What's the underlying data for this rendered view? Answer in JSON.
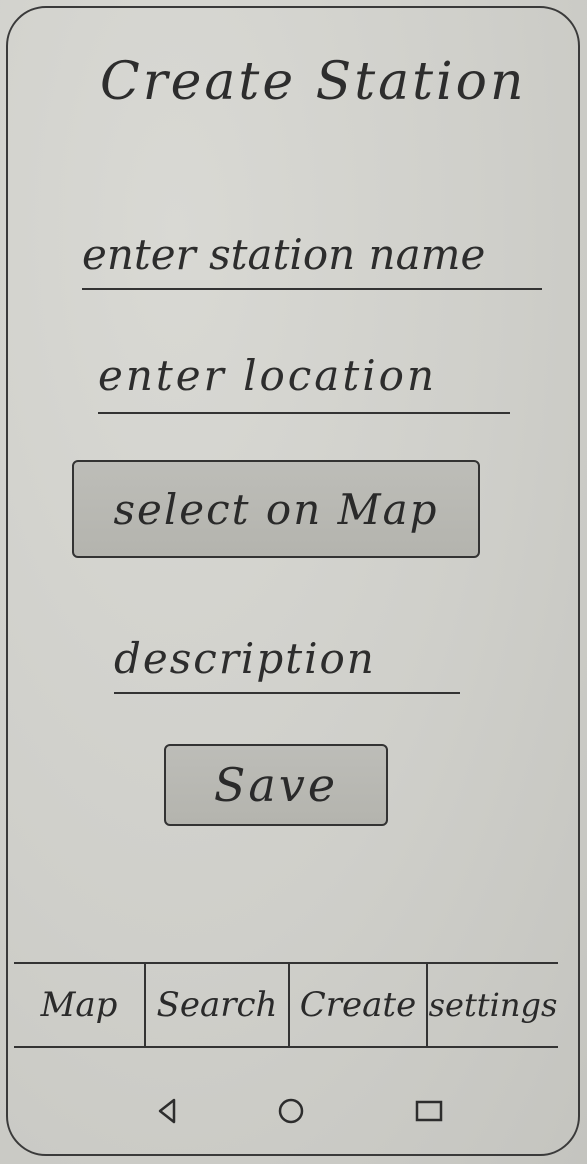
{
  "header": {
    "title": "Create Station"
  },
  "form": {
    "station_name_placeholder": "enter station name",
    "location_placeholder": "enter location",
    "select_on_map_label": "select on Map",
    "description_placeholder": "description",
    "save_label": "Save"
  },
  "tabs": [
    {
      "label": "Map"
    },
    {
      "label": "Search"
    },
    {
      "label": "Create"
    },
    {
      "label": "settings"
    }
  ],
  "system_nav": {
    "icons": [
      "back-icon",
      "home-icon",
      "recent-apps-icon"
    ]
  }
}
